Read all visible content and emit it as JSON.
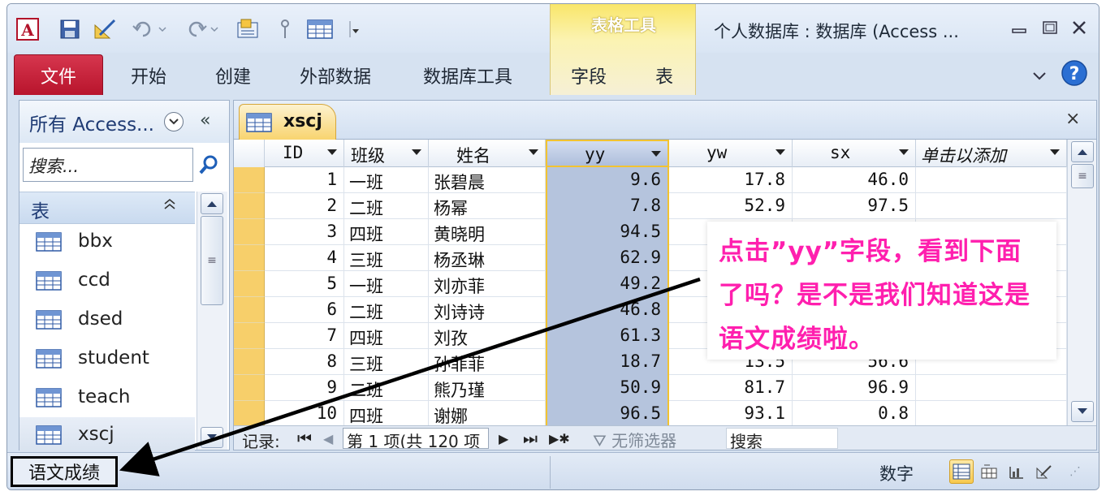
{
  "window": {
    "title": "个人数据库 : 数据库 (Access ...",
    "context_tab_group": "表格工具",
    "app_icon_letter": "A"
  },
  "ribbon": {
    "file_tab": "文件",
    "tabs": [
      "开始",
      "创建",
      "外部数据",
      "数据库工具"
    ],
    "context_tabs": [
      "字段",
      "表"
    ]
  },
  "nav_pane": {
    "title": "所有 Access...",
    "collapse_glyph": "«",
    "search_placeholder": "搜索...",
    "group_label": "表",
    "group_toggle": "⌃",
    "items": [
      "bbx",
      "ccd",
      "dsed",
      "student",
      "teach",
      "xscj"
    ],
    "selected_item": "xscj"
  },
  "document": {
    "tab_label": "xscj",
    "close_glyph": "×",
    "columns": [
      "ID",
      "班级",
      "姓名",
      "yy",
      "yw",
      "sx",
      "单击以添加"
    ],
    "selected_column": "yy",
    "rows": [
      [
        "1",
        "一班",
        "张碧晨",
        "9.6",
        "17.8",
        "46.0"
      ],
      [
        "2",
        "二班",
        "杨幂",
        "7.8",
        "52.9",
        "97.5"
      ],
      [
        "3",
        "四班",
        "黄晓明",
        "94.5",
        "",
        ""
      ],
      [
        "4",
        "三班",
        "杨丞琳",
        "62.9",
        "",
        ""
      ],
      [
        "5",
        "一班",
        "刘亦菲",
        "49.2",
        "",
        ""
      ],
      [
        "6",
        "二班",
        "刘诗诗",
        "46.8",
        "",
        ""
      ],
      [
        "7",
        "四班",
        "刘孜",
        "61.3",
        "",
        ""
      ],
      [
        "8",
        "三班",
        "孙菲菲",
        "18.7",
        "13.5",
        "56.6"
      ],
      [
        "9",
        "二班",
        "熊乃瑾",
        "50.9",
        "81.7",
        "96.9"
      ],
      [
        "10",
        "四班",
        "谢娜",
        "96.5",
        "93.1",
        "0.8"
      ]
    ]
  },
  "record_nav": {
    "label": "记录:",
    "position": "第 1 项(共 120 项",
    "filter": "无筛选器",
    "search": "搜索"
  },
  "status_bar": {
    "field_description": "语文成绩",
    "num_lock": "数字"
  },
  "annotation": {
    "text": "点击”yy”字段，看到下面了吗？是不是我们知道这是语文成绩啦。",
    "color": "#ff1fae"
  },
  "icons": [
    "access-logo-icon",
    "save-icon",
    "design-icon",
    "undo-icon",
    "redo-icon",
    "view-icon",
    "pin-icon",
    "table-icon",
    "customize-icon",
    "minimize-icon",
    "restore-icon",
    "close-icon",
    "help-icon",
    "search-icon",
    "table-icon",
    "first-record-icon",
    "prev-record-icon",
    "next-record-icon",
    "last-record-icon",
    "new-record-icon",
    "filter-icon",
    "datasheet-view-icon",
    "pivottable-icon",
    "pivotchart-icon",
    "design-view-icon"
  ]
}
